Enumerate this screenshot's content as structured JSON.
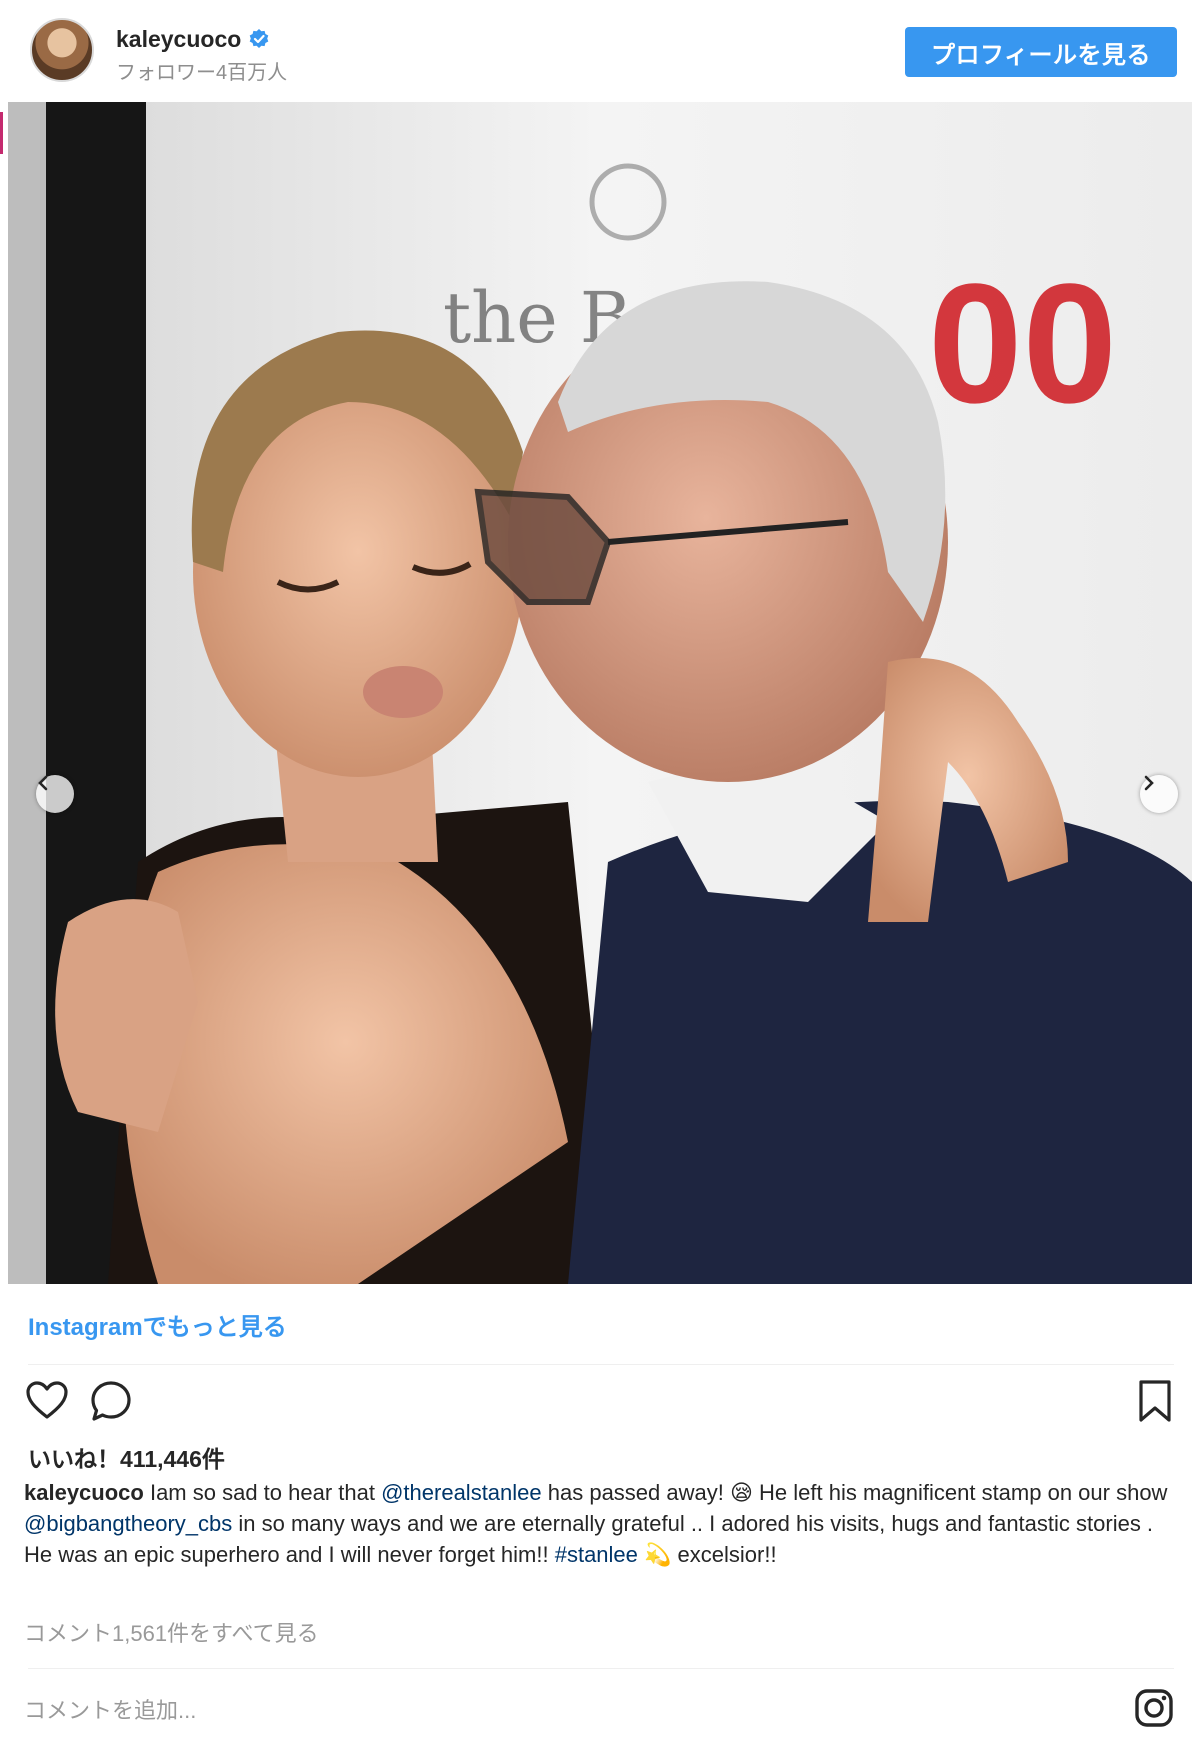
{
  "header": {
    "username": "kaleycuoco",
    "followers": "フォロワー4百万人",
    "profile_button": "プロフィールを見る",
    "verified_icon": "verified-badge-icon"
  },
  "photo": {
    "description_icon": "photo",
    "backdrop_logo_letters": "the B",
    "backdrop_number": "00",
    "prev_icon": "chevron-left-icon",
    "next_icon": "chevron-right-icon"
  },
  "more_link": "Instagramでもっと見る",
  "actions": {
    "like_icon": "heart-icon",
    "comment_icon": "comment-icon",
    "save_icon": "bookmark-icon"
  },
  "likes_text": "いいね！411,446件",
  "caption": {
    "user": "kaleycuoco",
    "part1": " Iam so sad to hear that ",
    "mention1": "@therealstanlee",
    "part2": " has passed away! 😪 He left his magnificent stamp on our show ",
    "mention2": "@bigbangtheory_cbs",
    "part3": " in so many ways and we are eternally grateful .. I adored his visits, hugs and fantastic stories . He was an epic superhero and I will never forget him!! ",
    "hashtag": "#stanlee",
    "part4": " 💫 excelsior!!"
  },
  "view_comments": "コメント1,561件をすべて見る",
  "add_comment_placeholder": "コメントを追加...",
  "colors": {
    "accent": "#3897f0",
    "link": "#003569",
    "muted": "#999999",
    "text": "#262626"
  }
}
